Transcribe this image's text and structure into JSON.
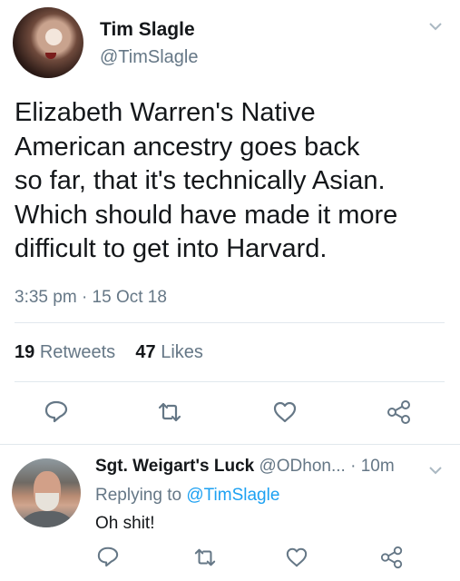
{
  "tweet": {
    "author_name": "Tim Slagle",
    "author_handle": "@TimSlagle",
    "text": "Elizabeth Warren's Native\nAmerican ancestry goes back\nso far, that it's technically Asian.\nWhich should have made it more\ndifficult to get into Harvard.",
    "time": "3:35 pm",
    "date_sep": "·",
    "date": "15 Oct 18",
    "retweets_count": "19",
    "retweets_label": "Retweets",
    "likes_count": "47",
    "likes_label": "Likes",
    "icons": [
      "chevron-down-icon",
      "reply-icon",
      "retweet-icon",
      "like-icon",
      "share-icon"
    ]
  },
  "reply": {
    "author_name": "Sgt. Weigart's Luck",
    "author_handle": "@ODhon...",
    "time_sep": "·",
    "time": "10m",
    "replying_prefix": "Replying to",
    "replying_handle": "@TimSlagle",
    "text": "Oh shit!",
    "icons": [
      "chevron-down-icon",
      "reply-icon",
      "retweet-icon",
      "like-icon",
      "share-icon"
    ]
  },
  "colors": {
    "text": "#14171a",
    "muted": "#657786",
    "link": "#1da1f2",
    "divider": "#e1e8ed"
  }
}
